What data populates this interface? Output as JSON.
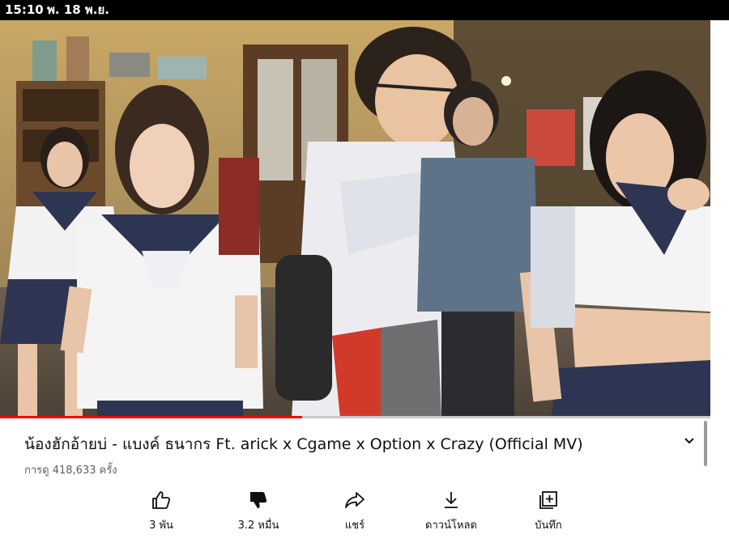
{
  "status_bar": {
    "time": "15:10",
    "date": "พ. 18 พ.ย."
  },
  "video": {
    "progress": 0.425
  },
  "title": "น้องฮักอ้ายบ่ - แบงค์ ธนากร Ft. arick x Cgame x Option x Crazy (Official MV)",
  "views": "การดู 418,633 ครั้ง",
  "actions": {
    "like": {
      "label": "3 พัน",
      "icon": "thumbs-up-icon"
    },
    "dislike": {
      "label": "3.2 หมื่น",
      "icon": "thumbs-down-icon"
    },
    "share": {
      "label": "แชร์",
      "icon": "share-icon"
    },
    "download": {
      "label": "ดาวน์โหลด",
      "icon": "download-icon"
    },
    "save": {
      "label": "บันทึก",
      "icon": "save-playlist-icon"
    }
  },
  "colors": {
    "progress": "#ff0000",
    "status_bar": "#000000",
    "text": "#0f0f0f",
    "secondary_text": "#606060"
  }
}
